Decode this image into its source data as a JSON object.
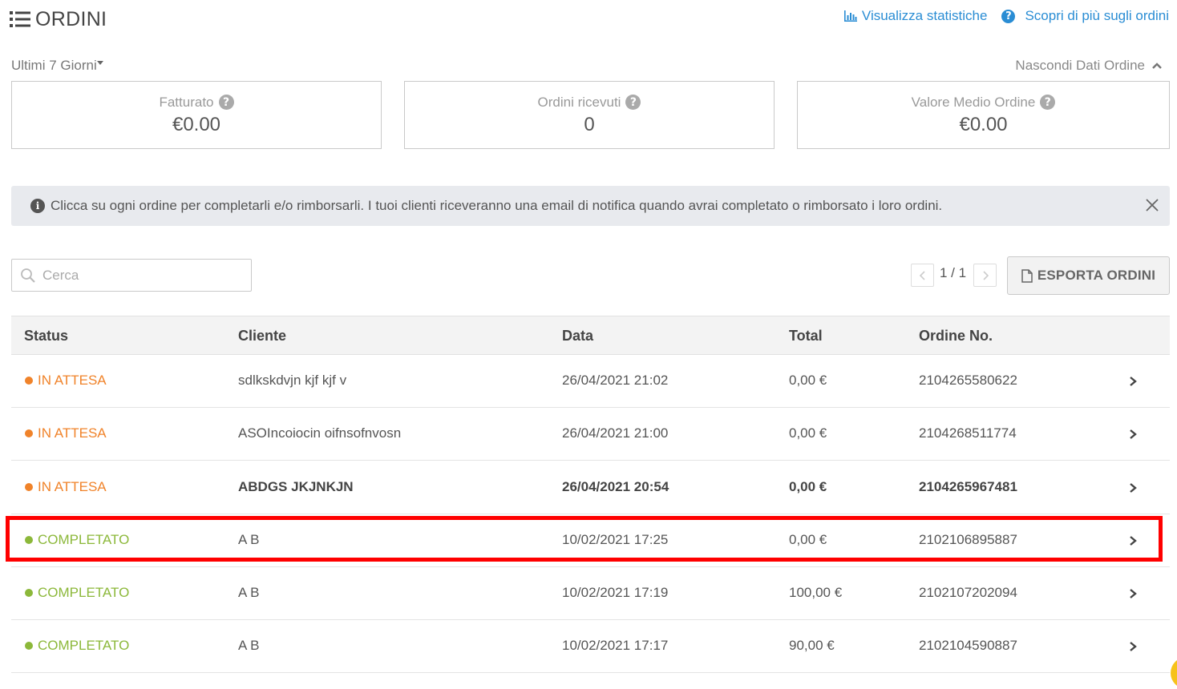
{
  "header": {
    "title": "ORDINI",
    "stats_link": "Visualizza statistiche",
    "learn_link": "Scopri di più sugli ordini"
  },
  "filters": {
    "range_label": "Ultimi 7 Giorni",
    "hide_data_label": "Nascondi Dati Ordine"
  },
  "stats": [
    {
      "label": "Fatturato",
      "value": "€0.00"
    },
    {
      "label": "Ordini ricevuti",
      "value": "0"
    },
    {
      "label": "Valore Medio Ordine",
      "value": "€0.00"
    }
  ],
  "banner": {
    "text": "Clicca su ogni ordine per completarli e/o rimborsarli. I tuoi clienti riceveranno una email di notifica quando avrai completato o rimborsato i loro ordini."
  },
  "search": {
    "placeholder": "Cerca",
    "value": ""
  },
  "pager": {
    "text": "1 / 1"
  },
  "export_label": "ESPORTA ORDINI",
  "table": {
    "headers": [
      "Status",
      "Cliente",
      "Data",
      "Total",
      "Ordine No."
    ],
    "rows": [
      {
        "status": "IN ATTESA",
        "customer": "sdlkskdvjn kjf kjf v",
        "date": "26/04/2021 21:02",
        "total": "0,00 €",
        "order_no": "2104265580622"
      },
      {
        "status": "IN ATTESA",
        "customer": "ASOIncoiocin oifnsofnvosn",
        "date": "26/04/2021 21:00",
        "total": "0,00 €",
        "order_no": "2104268511774"
      },
      {
        "status": "IN ATTESA",
        "customer": "ABDGS JKJNKJN",
        "date": "26/04/2021 20:54",
        "total": "0,00 €",
        "order_no": "2104265967481"
      },
      {
        "status": "COMPLETATO",
        "customer": "A B",
        "date": "10/02/2021 17:25",
        "total": "0,00 €",
        "order_no": "2102106895887"
      },
      {
        "status": "COMPLETATO",
        "customer": "A B",
        "date": "10/02/2021 17:19",
        "total": "100,00 €",
        "order_no": "2102107202094"
      },
      {
        "status": "COMPLETATO",
        "customer": "A B",
        "date": "10/02/2021 17:17",
        "total": "90,00 €",
        "order_no": "2102104590887"
      }
    ]
  },
  "colors": {
    "link": "#2a8dd4",
    "pending": "#f0832a",
    "completed": "#8cb83a",
    "highlight": "#ff0000",
    "fab": "#f6c21b"
  },
  "icons": {
    "title": "list-icon",
    "stats": "bar-chart-icon",
    "help": "question-circle-icon",
    "info": "info-circle-icon",
    "close": "close-icon",
    "search": "search-icon",
    "export": "file-icon",
    "row": "chevron-right-icon"
  }
}
